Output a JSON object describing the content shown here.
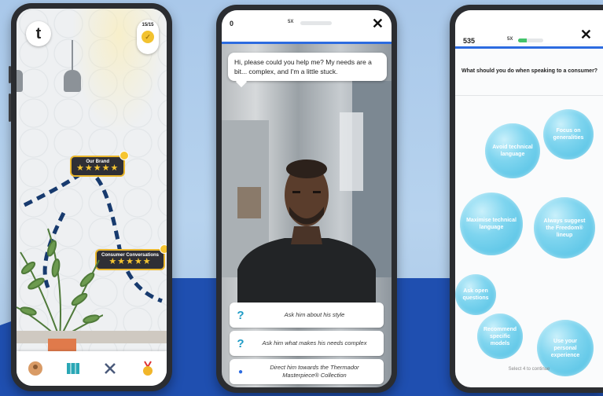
{
  "phone_map": {
    "counter_text": "15/15",
    "level_cards": [
      {
        "label": "Our Brand",
        "stars": "★★★★★"
      },
      {
        "label": "Consumer Conversations",
        "stars": "★★★★★"
      }
    ],
    "nav_icons": [
      "profile-icon",
      "map-icon",
      "tools-icon",
      "medal-icon"
    ]
  },
  "phone_chat": {
    "score": "0",
    "xp_label": "5X",
    "progress": 0.0,
    "close_label": "✕",
    "speech": "Hi, please could you help me? My needs are a bit... complex, and I'm a little stuck.",
    "options": [
      {
        "icon": "?",
        "text": "Ask him about his style"
      },
      {
        "icon": "?",
        "text": "Ask him what makes his needs complex"
      },
      {
        "icon": "●",
        "text": "Direct him towards the Thermador Masterpiece® Collection"
      }
    ]
  },
  "phone_quiz": {
    "score": "535",
    "xp_label": "5X",
    "progress": 0.35,
    "close_label": "✕",
    "question": "What should you do when speaking to a consumer?",
    "answers": [
      "Avoid technical language",
      "Focus on generalities",
      "Maximise technical language",
      "Always suggest the Freedom® lineup",
      "Ask open questions",
      "Recommend specific models",
      "Use your personal experience"
    ],
    "hint": "Select 4 to continue"
  },
  "colors": {
    "accent_blue": "#2c6be0",
    "progress_green": "#43c36b",
    "star_gold": "#f6c531",
    "bubble_blue": "#49bde2",
    "backdrop_blue": "#1f4fb0"
  }
}
